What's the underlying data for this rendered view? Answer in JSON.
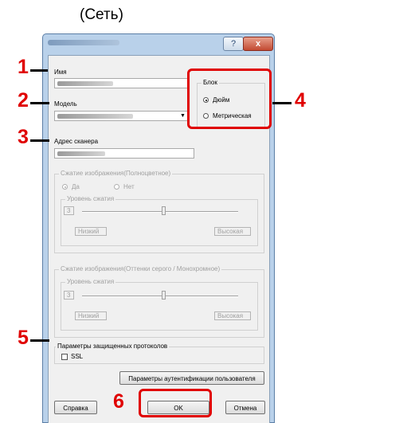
{
  "heading": "(Сеть)",
  "callouts": [
    "1",
    "2",
    "3",
    "4",
    "5",
    "6"
  ],
  "titlebar": {
    "help_icon": "?",
    "close_icon": "x"
  },
  "fields": {
    "name_label": "Имя",
    "model_label": "Модель",
    "scanner_address_label": "Адрес сканера"
  },
  "unit_group": {
    "title": "Блок",
    "options": [
      "Дюйм",
      "Метрическая"
    ],
    "selected": "Дюйм"
  },
  "color_compression": {
    "title": "Сжатие изображения(Полноцветное)",
    "yes_label": "Да",
    "no_label": "Нет",
    "level_title": "Уровень сжатия",
    "level_value": "3",
    "low_label": "Низкий",
    "high_label": "Высокая"
  },
  "gray_compression": {
    "title": "Сжатие изображения(Оттенки серого / Монохромное)",
    "level_title": "Уровень сжатия",
    "level_value": "3",
    "low_label": "Низкий",
    "high_label": "Высокая"
  },
  "secure": {
    "title": "Параметры защищенных протоколов",
    "ssl_label": "SSL"
  },
  "buttons": {
    "auth": "Параметры аутентификации пользователя",
    "help": "Справка",
    "ok": "OK",
    "cancel": "Отмена"
  },
  "colors": {
    "callout": "#e00000",
    "dialog_frame": "#b9d1ea"
  }
}
